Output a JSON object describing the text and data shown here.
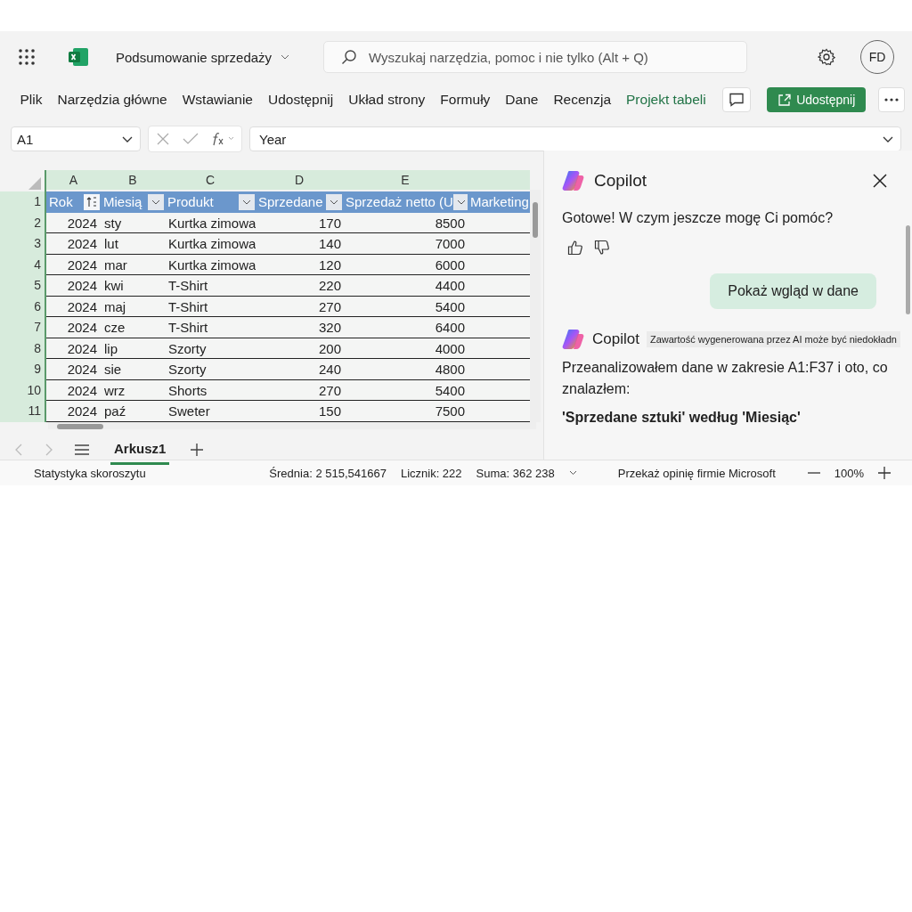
{
  "app_bar": {
    "document_title": "Podsumowanie sprzedaży",
    "search": {
      "placeholder": "Wyszukaj narzędzia, pomoc i nie tylko (Alt + Q)"
    },
    "avatar": "FD"
  },
  "ribbon": {
    "tabs": [
      {
        "label": "Plik",
        "kind": "standard"
      },
      {
        "label": "Narzędzia główne",
        "kind": "standard"
      },
      {
        "label": "Wstawianie",
        "kind": "standard"
      },
      {
        "label": "Udostępnij",
        "kind": "standard"
      },
      {
        "label": "Układ strony",
        "kind": "standard"
      },
      {
        "label": "Formuły",
        "kind": "standard"
      },
      {
        "label": "Dane",
        "kind": "standard"
      },
      {
        "label": "Recenzja",
        "kind": "standard"
      },
      {
        "label": "Projekt tabeli",
        "kind": "contextual"
      }
    ],
    "share_button": "Udostępnij"
  },
  "formula_bar": {
    "name_box": "A1",
    "formula": "Year"
  },
  "sheet": {
    "column_letters": [
      "A",
      "B",
      "C",
      "D",
      "E"
    ],
    "table": {
      "row_number": "1",
      "headers": [
        {
          "label": "Rok",
          "kind": "sort"
        },
        {
          "label": "Miesią",
          "kind": "filter"
        },
        {
          "label": "Produkt",
          "kind": "filter"
        },
        {
          "label": "Sprzedane",
          "kind": "filter"
        },
        {
          "label": "Sprzedaż netto (U",
          "kind": "filter"
        },
        {
          "label": "Marketing",
          "kind": "plain"
        }
      ],
      "rows": [
        {
          "row_number": "2",
          "cells": [
            "2024",
            "sty",
            "Kurtka zimowa",
            "170",
            "8500"
          ]
        },
        {
          "row_number": "3",
          "cells": [
            "2024",
            "lut",
            "Kurtka zimowa",
            "140",
            "7000"
          ]
        },
        {
          "row_number": "4",
          "cells": [
            "2024",
            "mar",
            "Kurtka zimowa",
            "120",
            "6000"
          ]
        },
        {
          "row_number": "5",
          "cells": [
            "2024",
            "kwi",
            "T-Shirt",
            "220",
            "4400"
          ]
        },
        {
          "row_number": "6",
          "cells": [
            "2024",
            "maj",
            "T-Shirt",
            "270",
            "5400"
          ]
        },
        {
          "row_number": "7",
          "cells": [
            "2024",
            "cze",
            "T-Shirt",
            "320",
            "6400"
          ]
        },
        {
          "row_number": "8",
          "cells": [
            "2024",
            "lip",
            "Szorty",
            "200",
            "4000"
          ]
        },
        {
          "row_number": "9",
          "cells": [
            "2024",
            "sie",
            "Szorty",
            "240",
            "4800"
          ]
        },
        {
          "row_number": "10",
          "cells": [
            "2024",
            "wrz",
            "Shorts",
            "270",
            "5400"
          ]
        },
        {
          "row_number": "11",
          "cells": [
            "2024",
            "paź",
            "Sweter",
            "150",
            "7500"
          ]
        }
      ]
    }
  },
  "sheet_tabs": [
    {
      "label": "Arkusz1",
      "selected": true
    }
  ],
  "copilot": {
    "title": "Copilot",
    "greeting": "Gotowe! W czym jeszcze mogę Ci pomóc?",
    "user_prompt": "Pokaż wgląd w dane",
    "reply": {
      "name": "Copilot",
      "disclaimer": "Zawartość wygenerowana przez AI może być niedokładn",
      "text": "Przeanalizowałem dane w zakresie A1:F37 i oto, co znalazłem:",
      "heading": "'Sprzedane sztuki' według 'Miesiąc'"
    }
  },
  "status_bar": {
    "workbook_stats": "Statystyka skoroszytu",
    "average": "Średnia: 2 515,541667",
    "count": "Licznik: 222",
    "sum": "Suma: 362 238",
    "feedback": "Przekaż opinię firmie Microsoft",
    "zoom": "100%"
  }
}
